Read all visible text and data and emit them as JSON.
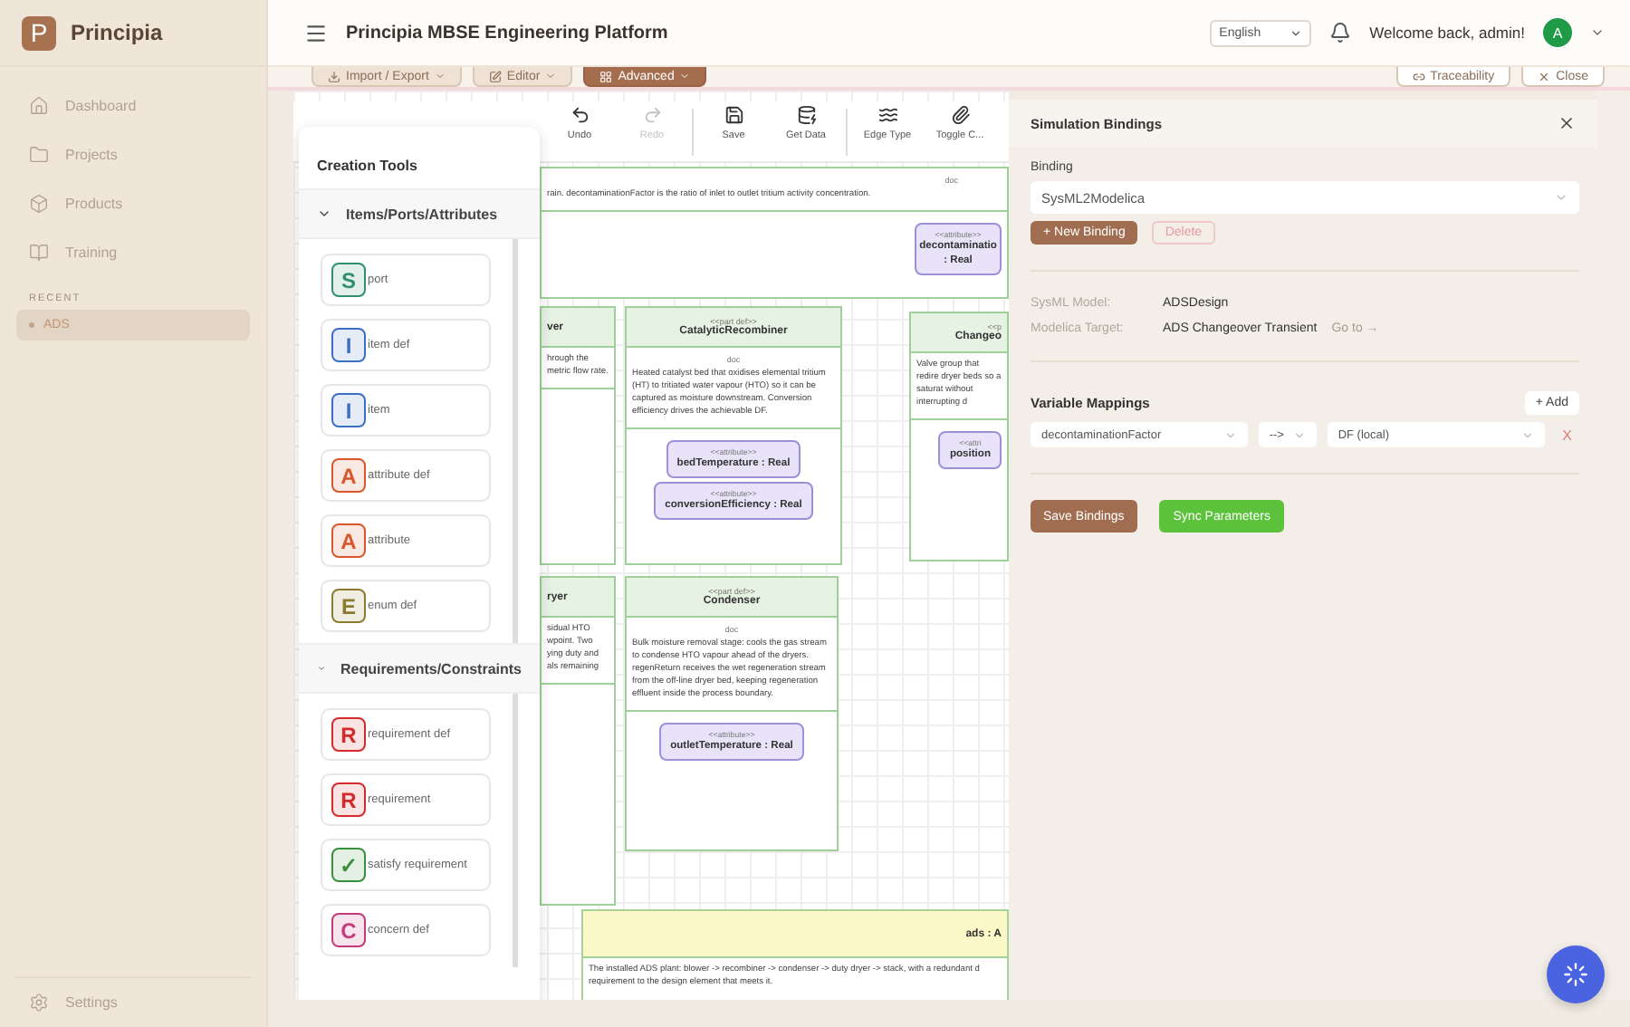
{
  "sidebar": {
    "logo": "P",
    "app_name": "Principia",
    "nav": [
      {
        "label": "Dashboard",
        "selected": false
      },
      {
        "label": "Projects",
        "selected": false
      },
      {
        "label": "Products",
        "selected": false
      },
      {
        "label": "Training",
        "selected": false
      }
    ],
    "recent_heading": "RECENT",
    "recent": [
      {
        "label": "ADS",
        "selected": true
      }
    ],
    "settings": "Settings"
  },
  "header": {
    "title": "Principia MBSE Engineering Platform",
    "language": "English",
    "welcome": "Welcome back, admin!",
    "avatar": "A"
  },
  "action_bar": {
    "left": [
      {
        "label": "Import / Export",
        "kind": "menu"
      },
      {
        "label": "Editor",
        "kind": "menu"
      },
      {
        "label": "Advanced",
        "kind": "primary"
      }
    ],
    "right": [
      {
        "label": "Traceability"
      },
      {
        "label": "Close"
      }
    ]
  },
  "toolbar": [
    {
      "label": "Undo",
      "disabled": false
    },
    {
      "label": "Redo",
      "disabled": true
    },
    {
      "label": "Save",
      "disabled": false
    },
    {
      "label": "Get Data",
      "disabled": false
    },
    {
      "label": "Edge Type",
      "disabled": false
    },
    {
      "label": "Toggle C...",
      "disabled": false
    }
  ],
  "creation_tools": {
    "title": "Creation Tools",
    "sections": [
      {
        "title": "Items/Ports/Attributes",
        "expanded": true,
        "tools": [
          {
            "badge": "S",
            "label": "port",
            "color": "#2f8f6f"
          },
          {
            "badge": "I",
            "label": "item def",
            "color": "#3b6fc4"
          },
          {
            "badge": "I",
            "label": "item",
            "color": "#3b6fc4"
          },
          {
            "badge": "A",
            "label": "attribute def",
            "color": "#d9572b"
          },
          {
            "badge": "A",
            "label": "attribute",
            "color": "#d9572b"
          },
          {
            "badge": "E",
            "label": "enum def",
            "color": "#8c7a2e"
          }
        ]
      },
      {
        "title": "Requirements/Constraints",
        "expanded": true,
        "tools": [
          {
            "badge": "R",
            "label": "requirement def",
            "color": "#d42a2a"
          },
          {
            "badge": "R",
            "label": "requirement",
            "color": "#d42a2a"
          },
          {
            "badge": "✓",
            "label": "satisfy requirement",
            "color": "#3a8f3a"
          },
          {
            "badge": "C",
            "label": "concern def",
            "color": "#c43a7a"
          }
        ]
      }
    ]
  },
  "diagram": {
    "nodes": [
      {
        "kind": "banner",
        "doc_label": "doc",
        "doc": "rain. decontaminationFactor is the ratio of inlet to outlet tritium activity concentration.",
        "attributes": [
          {
            "stereotype": "<<attribute>>",
            "name": "decontaminatio : Real"
          }
        ]
      },
      {
        "kind": "part-cut-left",
        "name": "ver",
        "doc": "hrough the metric flow rate."
      },
      {
        "kind": "part",
        "stereotype": "<<part def>>",
        "name": "CatalyticRecombiner",
        "doc_label": "doc",
        "doc": "Heated catalyst bed that oxidises elemental tritium (HT) to tritiated water vapour (HTO) so it can be captured as moisture downstream. Conversion efficiency drives the achievable DF.",
        "attributes": [
          {
            "stereotype": "<<attribute>>",
            "name": "bedTemperature : Real"
          },
          {
            "stereotype": "<<attribute>>",
            "name": "conversionEfficiency : Real"
          }
        ]
      },
      {
        "kind": "part-cut-right",
        "stereotype": "<<p",
        "name": "Changeo",
        "doc": "Valve group that redire dryer beds so a saturat without interrupting d",
        "attributes": [
          {
            "stereotype": "<<attri",
            "name": "position"
          }
        ]
      },
      {
        "kind": "part-cut-left",
        "name": "ryer",
        "doc": "sidual HTO wpoint. Two ying duty and als remaining"
      },
      {
        "kind": "part",
        "stereotype": "<<part def>>",
        "name": "Condenser",
        "doc_label": "doc",
        "doc": "Bulk moisture removal stage: cools the gas stream to condense HTO vapour ahead of the dryers. regenReturn receives the wet regeneration stream from the off-line dryer bed, keeping regeneration effluent inside the process boundary.",
        "attributes": [
          {
            "stereotype": "<<attribute>>",
            "name": "outletTemperature : Real"
          }
        ]
      },
      {
        "kind": "note",
        "name": "ads : A",
        "doc": "The installed ADS plant: blower -> recombiner -> condenser -> duty dryer -> stack, with a redundant d requirement to the design element that meets it."
      }
    ]
  },
  "bindings_panel": {
    "title": "Simulation Bindings",
    "binding_label": "Binding",
    "binding": "SysML2Modelica",
    "new_binding": "+ New Binding",
    "delete": "Delete",
    "sysml_model_label": "SysML Model:",
    "sysml_model": "ADSDesign",
    "target_label": "Modelica Target:",
    "target": "ADS Changeover Transient",
    "goto": "Go to →",
    "mappings_title": "Variable Mappings",
    "add": "+ Add",
    "mappings": [
      {
        "source": "decontaminationFactor",
        "direction": "-->",
        "target": "DF (local)",
        "remove": "X"
      }
    ],
    "save": "Save Bindings",
    "sync": "Sync Parameters"
  }
}
